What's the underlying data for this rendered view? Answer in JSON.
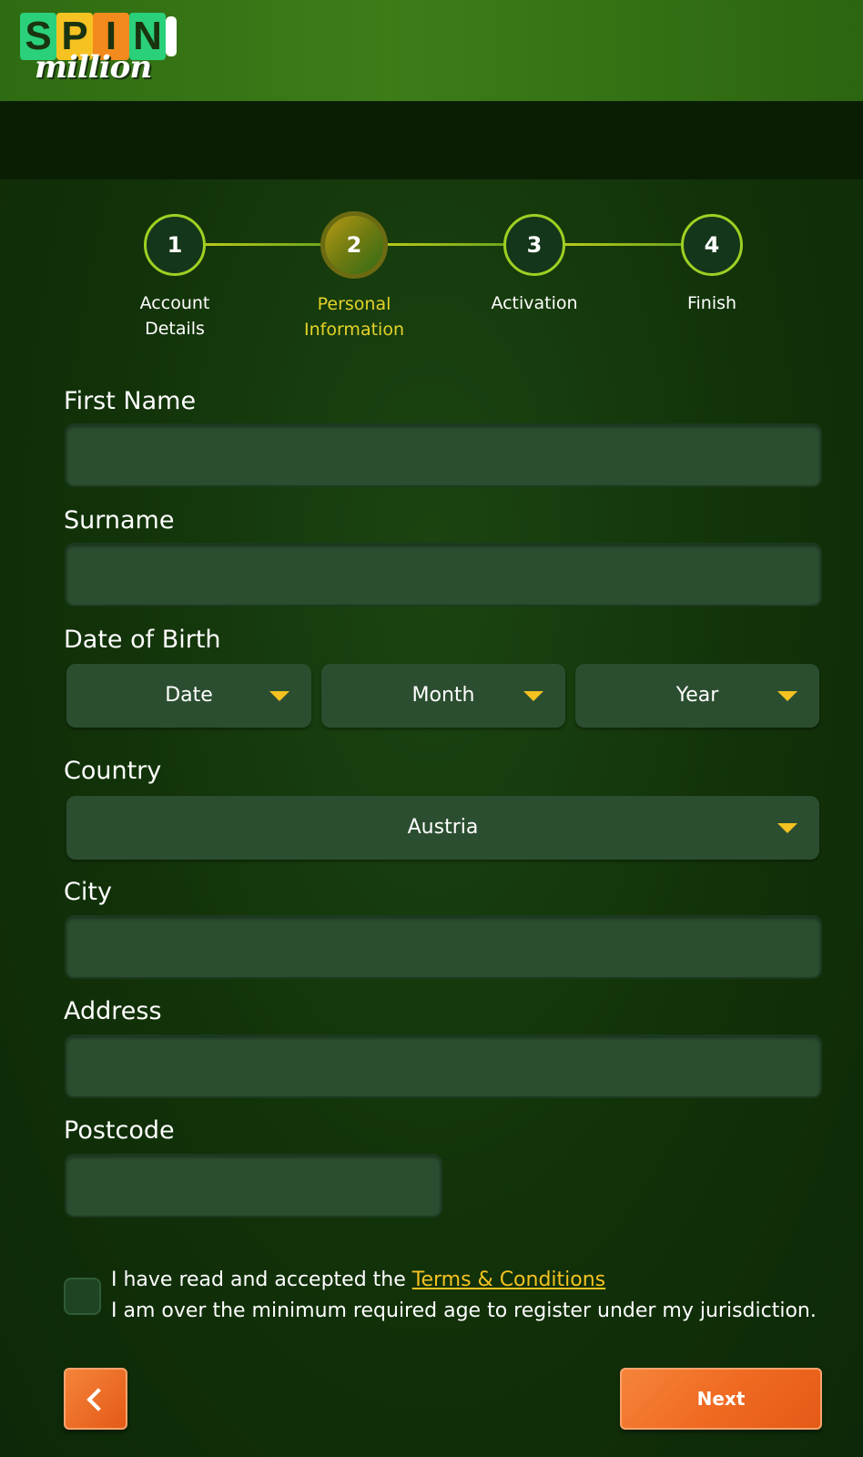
{
  "logo": {
    "letters": [
      "S",
      "P",
      "I",
      "N"
    ],
    "word": "million"
  },
  "steps": [
    {
      "number": "1",
      "label_line1": "Account",
      "label_line2": "Details",
      "active": false
    },
    {
      "number": "2",
      "label_line1": "Personal",
      "label_line2": "Information",
      "active": true
    },
    {
      "number": "3",
      "label_line1": "Activation",
      "label_line2": "",
      "active": false
    },
    {
      "number": "4",
      "label_line1": "Finish",
      "label_line2": "",
      "active": false
    }
  ],
  "form": {
    "first_name_label": "First Name",
    "first_name_value": "",
    "surname_label": "Surname",
    "surname_value": "",
    "dob_label": "Date of Birth",
    "dob_date": "Date",
    "dob_month": "Month",
    "dob_year": "Year",
    "country_label": "Country",
    "country_value": "Austria",
    "city_label": "City",
    "city_value": "",
    "address_label": "Address",
    "address_value": "",
    "postcode_label": "Postcode",
    "postcode_value": ""
  },
  "terms": {
    "prefix": "I have read and accepted the ",
    "link": "Terms & Conditions",
    "line2": "I am over the minimum required age to register under my jurisdiction.",
    "checked": false
  },
  "buttons": {
    "next_label": "Next"
  },
  "colors": {
    "accent": "#f5c222",
    "button": "#f06a22",
    "field": "#2b4e30",
    "background": "#123209"
  }
}
